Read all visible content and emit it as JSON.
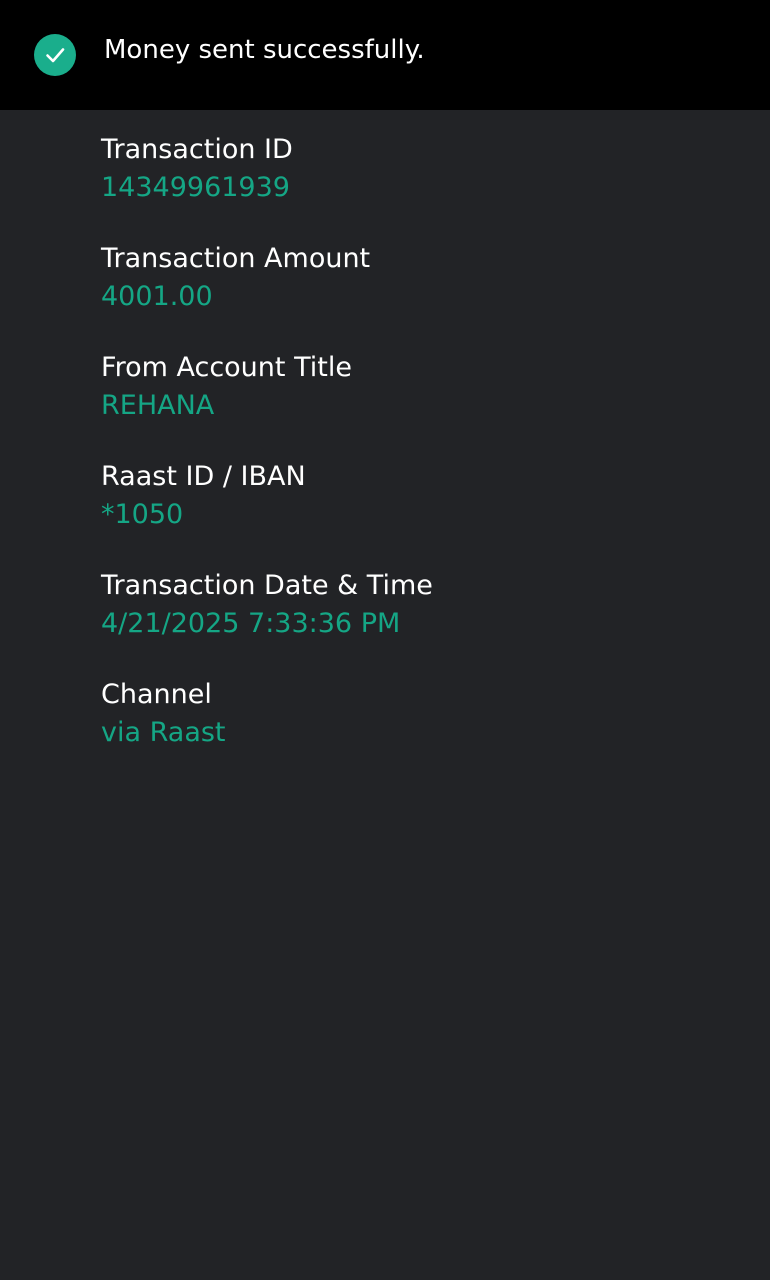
{
  "colors": {
    "header_background": "#000000",
    "page_background": "#222326",
    "label_text": "#ffffff",
    "value_text": "#15a685",
    "success_icon": "#1aae8c"
  },
  "header": {
    "icon": "check-circle-icon",
    "message": "Money sent successfully."
  },
  "details": [
    {
      "label": "Transaction ID",
      "value": "14349961939"
    },
    {
      "label": "Transaction Amount",
      "value": "4001.00"
    },
    {
      "label": "From Account Title",
      "value": "REHANA"
    },
    {
      "label": "Raast ID / IBAN",
      "value": "*1050"
    },
    {
      "label": "Transaction Date & Time",
      "value": "4/21/2025 7:33:36 PM"
    },
    {
      "label": "Channel",
      "value": "via Raast"
    }
  ]
}
